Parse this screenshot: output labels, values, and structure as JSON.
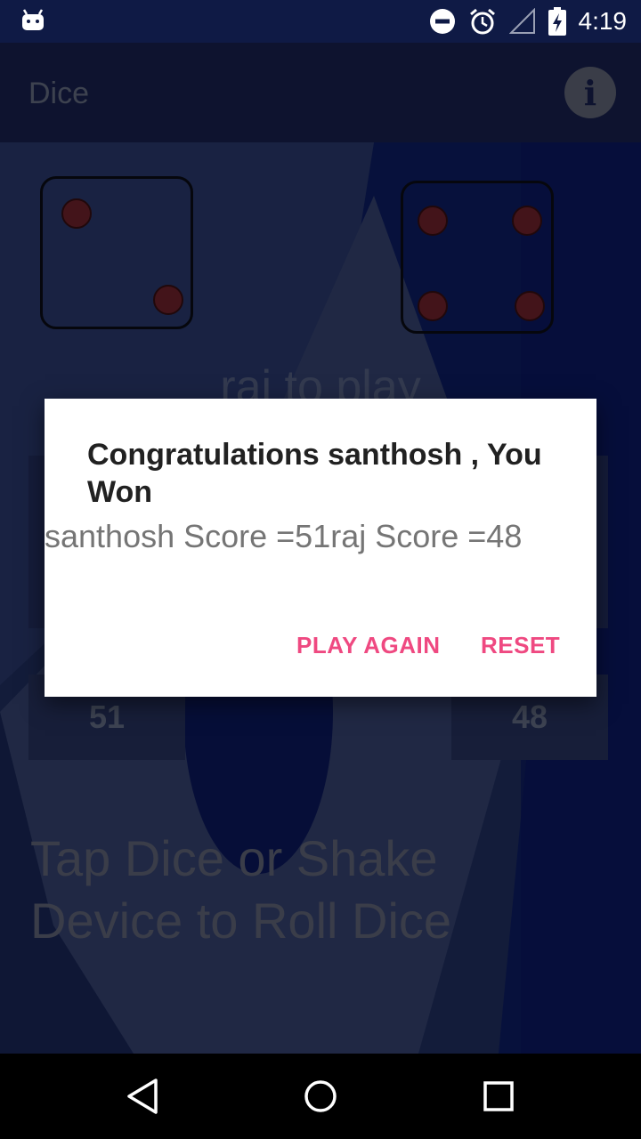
{
  "status_bar": {
    "time": "4:19",
    "icons": [
      "android-debug-icon",
      "do-not-disturb-icon",
      "alarm-icon",
      "signal-icon",
      "battery-charging-icon"
    ]
  },
  "app_bar": {
    "title": "Dice",
    "info_icon": "info-icon"
  },
  "game": {
    "dice": [
      {
        "value": 2
      },
      {
        "value": 4
      }
    ],
    "turn_text": "raj to play",
    "left_score": "51",
    "right_score": "48",
    "instructions": "Tap Dice or Shake Device to Roll Dice"
  },
  "dialog": {
    "title": "Congratulations santhosh , You Won",
    "message": "santhosh Score =51raj Score =48",
    "play_again_label": "PLAY AGAIN",
    "reset_label": "RESET"
  },
  "colors": {
    "accent": "#ef4981",
    "pip": "#7a2630",
    "app_bar": "#1b2456"
  },
  "nav_bar": {
    "icons": [
      "back-icon",
      "home-icon",
      "recents-icon"
    ]
  }
}
